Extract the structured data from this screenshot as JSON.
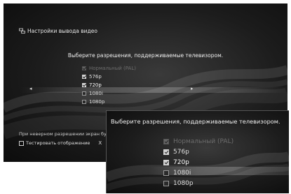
{
  "main": {
    "title": "Настройки вывода видео",
    "prompt": "Выберите разрешения, поддерживаемые телевизором.",
    "resolutions": [
      {
        "label": "Нормальный (PAL)",
        "checked": true,
        "enabled": false,
        "focused": false
      },
      {
        "label": "576p",
        "checked": true,
        "enabled": true,
        "focused": false
      },
      {
        "label": "720p",
        "checked": true,
        "enabled": true,
        "focused": true
      },
      {
        "label": "1080i",
        "checked": false,
        "enabled": true,
        "focused": false
      },
      {
        "label": "1080p",
        "checked": false,
        "enabled": true,
        "focused": false
      }
    ],
    "note": "При неверном разрешении экран бу",
    "bottom": {
      "test_label": "Тестировать отображение",
      "next_label": "Х"
    }
  },
  "zoom": {
    "prompt": "Выберите разрешения, поддерживаемые телевизором.",
    "resolutions": [
      {
        "label": "Нормальный (PAL)",
        "checked": true,
        "enabled": false
      },
      {
        "label": "576p",
        "checked": true,
        "enabled": true
      },
      {
        "label": "720p",
        "checked": true,
        "enabled": true,
        "focused": true
      },
      {
        "label": "1080i",
        "checked": false,
        "enabled": true
      },
      {
        "label": "1080p",
        "checked": false,
        "enabled": true
      }
    ]
  },
  "icons": {
    "settings": "settings-icon",
    "checkbox": "checkbox-icon",
    "square_button": "square-button-icon",
    "cross_button": "cross-button-icon",
    "arrow_left": "arrow-left-icon",
    "arrow_right": "arrow-right-icon"
  },
  "colors": {
    "background": "#1c1c1c",
    "text": "#e6e6e6",
    "disabled_text": "#6d6d6d"
  }
}
